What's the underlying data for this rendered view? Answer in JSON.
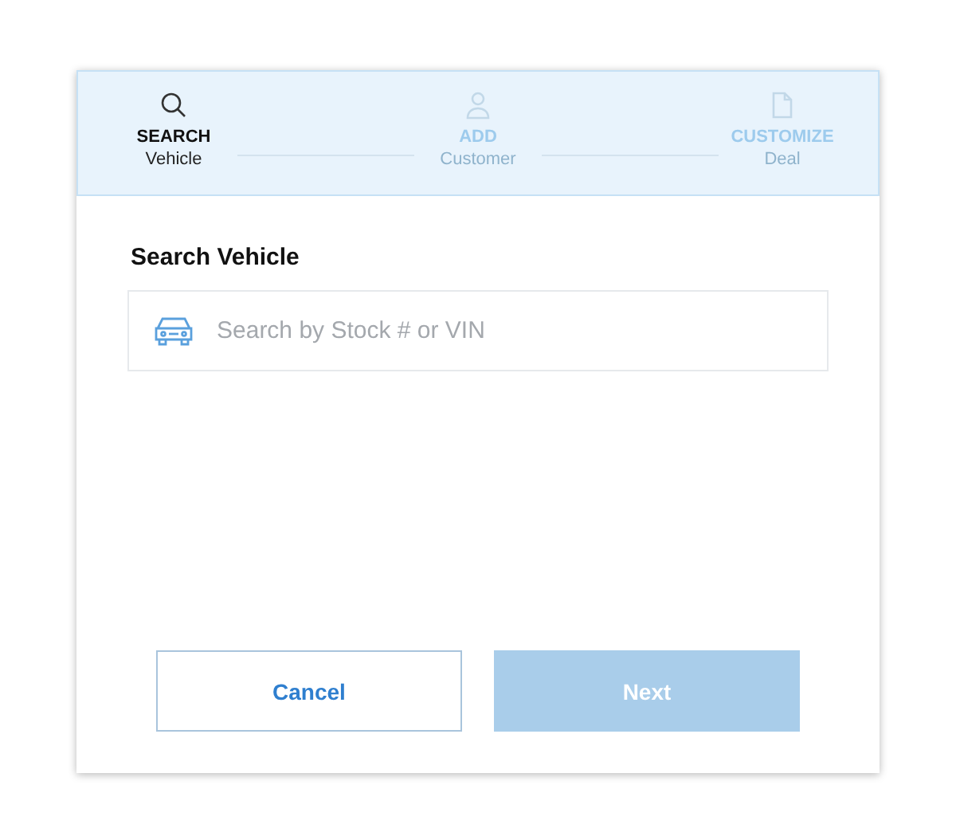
{
  "stepper": [
    {
      "kind": "search",
      "title": "SEARCH",
      "subtitle": "Vehicle",
      "selected": true
    },
    {
      "kind": "person",
      "title": "ADD",
      "subtitle": "Customer",
      "selected": false
    },
    {
      "kind": "document",
      "title": "CUSTOMIZE",
      "subtitle": "Deal",
      "selected": false
    }
  ],
  "heading": "Search Vehicle",
  "search": {
    "placeholder": "Search by Stock # or VIN"
  },
  "buttons": [
    {
      "label": "Cancel",
      "kind": "secondary",
      "disabled": false
    },
    {
      "label": "Next",
      "kind": "primary",
      "disabled": true
    }
  ]
}
